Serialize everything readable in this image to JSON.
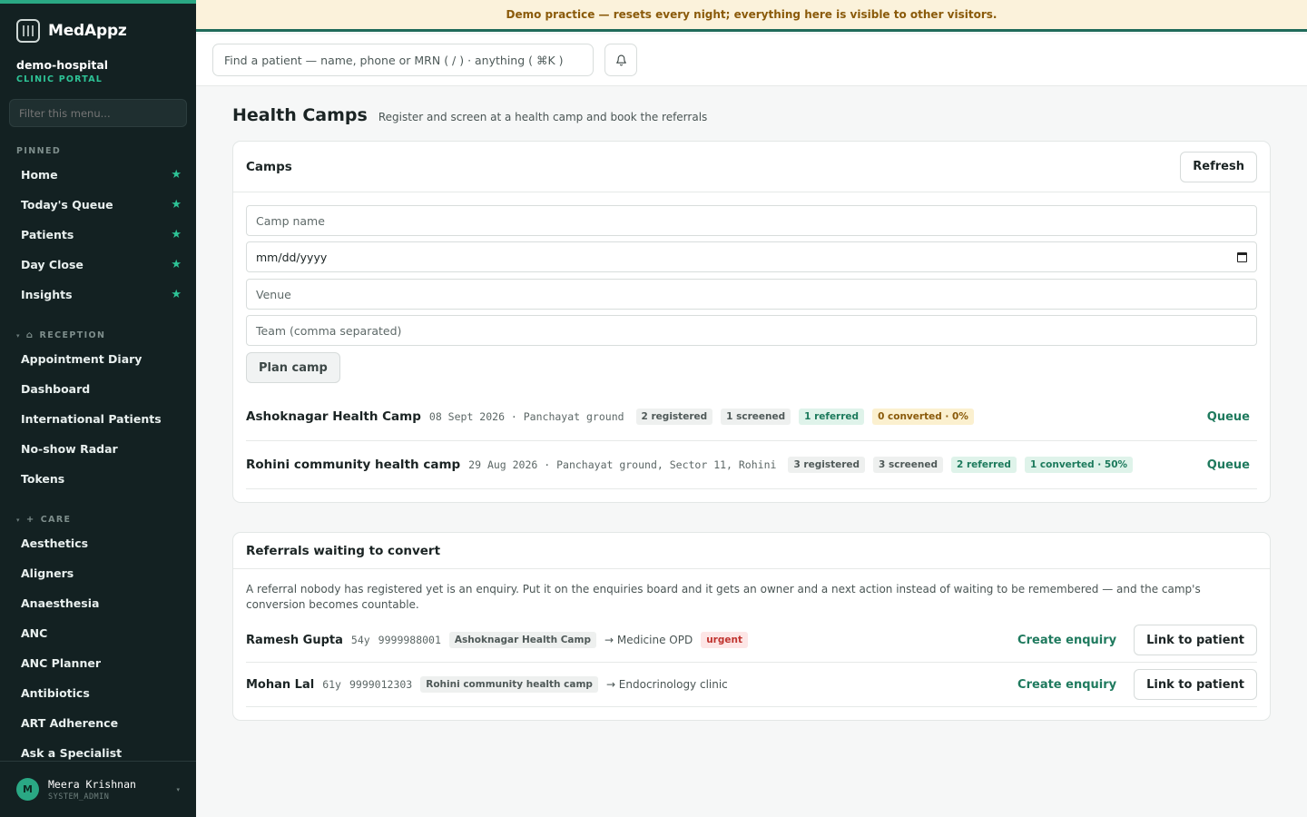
{
  "banner": {
    "text": "Demo practice — resets every night; everything here is visible to other visitors."
  },
  "brand": {
    "name": "MedAppz",
    "org_name": "demo-hospital",
    "org_sub": "CLINIC PORTAL"
  },
  "sidebar": {
    "filter_placeholder": "Filter this menu...",
    "pinned_label": "PINNED",
    "pinned": [
      {
        "label": "Home"
      },
      {
        "label": "Today's Queue"
      },
      {
        "label": "Patients"
      },
      {
        "label": "Day Close"
      },
      {
        "label": "Insights"
      }
    ],
    "reception_label": "RECEPTION",
    "reception": [
      {
        "label": "Appointment Diary"
      },
      {
        "label": "Dashboard"
      },
      {
        "label": "International Patients"
      },
      {
        "label": "No-show Radar"
      },
      {
        "label": "Tokens"
      }
    ],
    "care_label": "CARE",
    "care": [
      {
        "label": "Aesthetics"
      },
      {
        "label": "Aligners"
      },
      {
        "label": "Anaesthesia"
      },
      {
        "label": "ANC"
      },
      {
        "label": "ANC Planner"
      },
      {
        "label": "Antibiotics"
      },
      {
        "label": "ART Adherence"
      },
      {
        "label": "Ask a Specialist"
      }
    ],
    "user": {
      "initial": "M",
      "name": "Meera Krishnan",
      "role": "SYSTEM_ADMIN"
    }
  },
  "topbar": {
    "search_placeholder": "Find a patient — name, phone or MRN ( / ) · anything ( ⌘K )"
  },
  "page": {
    "title": "Health Camps",
    "subtitle": "Register and screen at a health camp and book the referrals"
  },
  "camps_card": {
    "title": "Camps",
    "refresh_label": "Refresh",
    "fields": {
      "camp_name_placeholder": "Camp name",
      "date_value": "mm/dd/yyyy",
      "venue_placeholder": "Venue",
      "team_placeholder": "Team (comma separated)"
    },
    "plan_label": "Plan camp",
    "queue_label": "Queue",
    "camps": [
      {
        "name": "Ashoknagar Health Camp",
        "meta": "08 Sept 2026 · Panchayat ground",
        "registered": "2 registered",
        "screened": "1 screened",
        "referred": "1 referred",
        "converted": "0 converted · 0%"
      },
      {
        "name": "Rohini community health camp",
        "meta": "29 Aug 2026 · Panchayat ground, Sector 11, Rohini",
        "registered": "3 registered",
        "screened": "3 screened",
        "referred": "2 referred",
        "converted": "1 converted · 50%"
      }
    ]
  },
  "referrals_card": {
    "title": "Referrals waiting to convert",
    "description": "A referral nobody has registered yet is an enquiry. Put it on the enquiries board and it gets an owner and a next action instead of waiting to be remembered — and the camp's conversion becomes countable.",
    "create_label": "Create enquiry",
    "link_label": "Link to patient",
    "referrals": [
      {
        "name": "Ramesh Gupta",
        "age": "54y",
        "phone": "9999988001",
        "camp": "Ashoknagar Health Camp",
        "destination": "→ Medicine OPD",
        "tag": "urgent"
      },
      {
        "name": "Mohan Lal",
        "age": "61y",
        "phone": "9999012303",
        "camp": "Rohini community health camp",
        "destination": "→ Endocrinology clinic",
        "tag": ""
      }
    ]
  },
  "colors": {
    "accent": "#2aa884",
    "sidebar_bg": "#132122",
    "banner_bg": "#fbf2db",
    "link": "#1f7a5e"
  }
}
